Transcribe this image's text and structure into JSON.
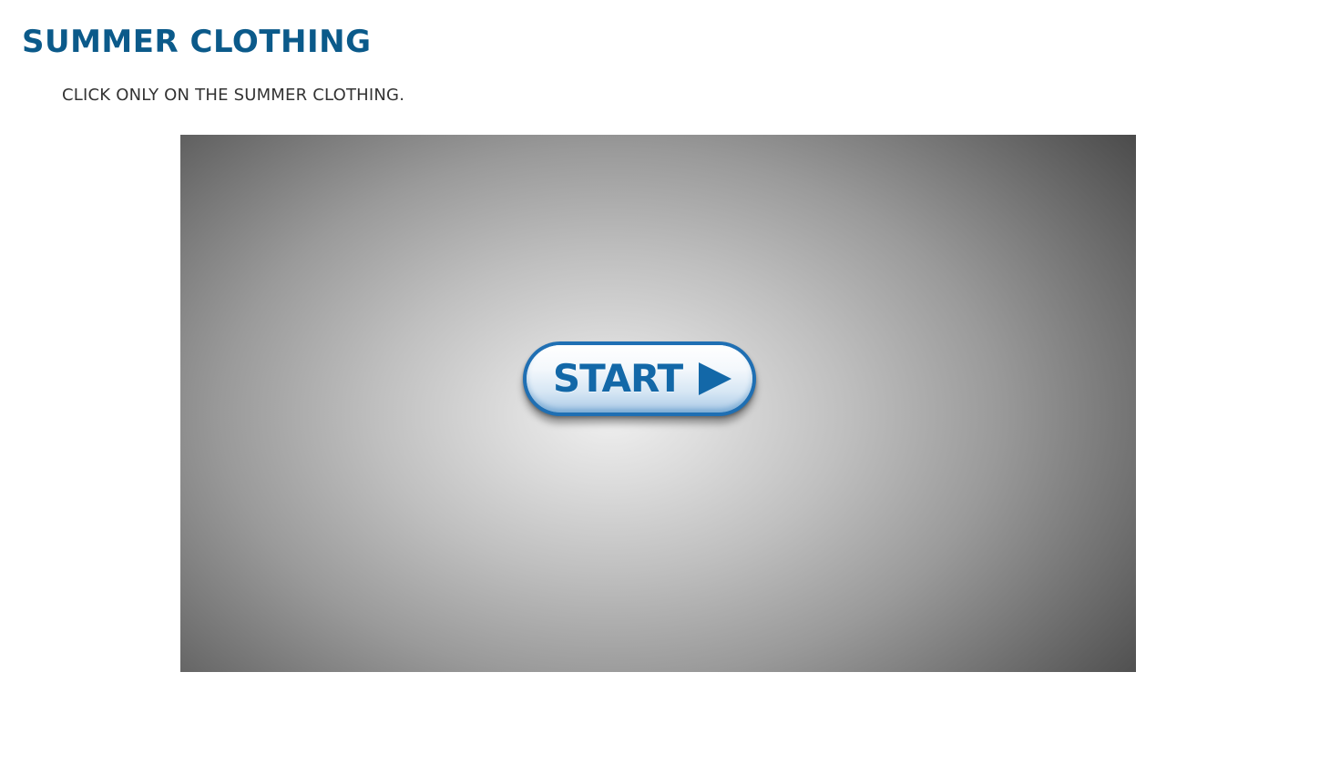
{
  "header": {
    "title": "SUMMER CLOTHING"
  },
  "instructions": {
    "text": "CLICK ONLY ON THE SUMMER CLOTHING."
  },
  "activity": {
    "start_button": {
      "label": "START",
      "icon": "play-icon"
    }
  },
  "colors": {
    "title": "#0b5a8a",
    "button_accent": "#1368a8",
    "button_border": "#1f6fb3"
  }
}
